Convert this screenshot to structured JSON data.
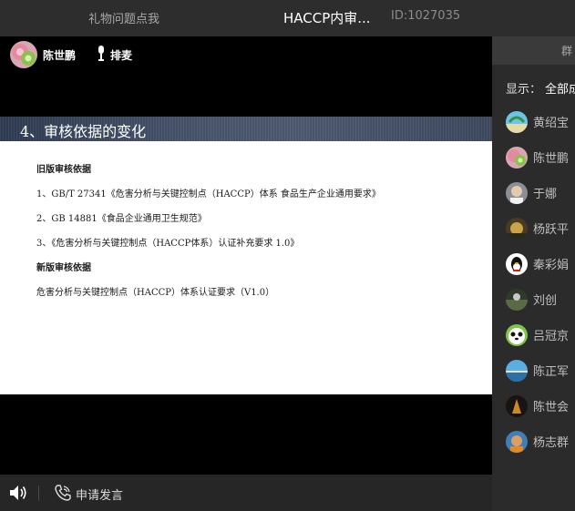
{
  "topbar": {
    "gift_link": "礼物问题点我",
    "title": "HACCP内审...",
    "room_id": "ID:1027035"
  },
  "stage": {
    "host_name": "陈世鹏",
    "mic_label": "排麦",
    "slide": {
      "title": "4、审核依据的变化",
      "lines": [
        "旧版审核依据",
        "1、GB/T 27341《危害分析与关键控制点（HACCP）体系 食品生产企业通用要求》",
        "2、GB 14881《食品企业通用卫生规范》",
        "3、《危害分析与关键控制点（HACCP体系）认证补充要求 1.0》",
        "新版审核依据",
        "危害分析与关键控制点（HACCP）体系认证要求（V1.0）"
      ]
    }
  },
  "bottombar": {
    "speaker_icon": "speaker-icon",
    "phone_icon": "phone-icon",
    "apply_label": "申请发言"
  },
  "panel": {
    "tab_label": "群",
    "filter_label": "显示：",
    "filter_value": "全部成",
    "members": [
      "黄绍宝",
      "陈世鹏",
      "于娜",
      "杨跃平",
      "秦彩娟",
      "刘创",
      "吕冠京",
      "陈正军",
      "陈世会",
      "杨志群"
    ]
  },
  "colors": {
    "topbar_bg": "#2d2d2d",
    "stage_bg": "#000000",
    "panel_bg": "#2b2b2b",
    "bottombar_bg": "#262626"
  }
}
